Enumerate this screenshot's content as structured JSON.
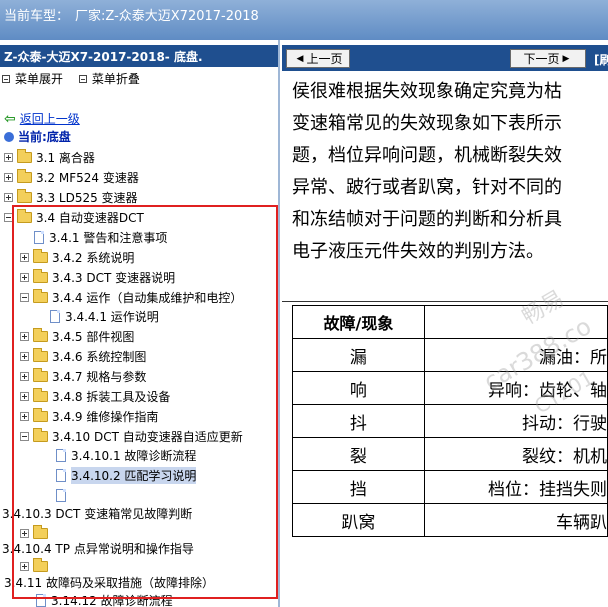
{
  "topbar": {
    "label": "当前车型：",
    "model": "厂家:Z-众泰大迈X72017-2018"
  },
  "left": {
    "title": "Z-众泰-大迈X7-2017-2018- 底盘.",
    "menu_expand": "菜单展开",
    "menu_collapse": "菜单折叠",
    "back": "返回上一级",
    "current": "当前:底盘",
    "items": [
      {
        "label": "3.1 离合器"
      },
      {
        "label": "3.2 MF524 变速器"
      },
      {
        "label": "3.3 LD525 变速器"
      },
      {
        "label": "3.4 自动变速器DCT"
      },
      {
        "label": "3.4.1 警告和注意事项"
      },
      {
        "label": "3.4.2 系统说明"
      },
      {
        "label": "3.4.3 DCT 变速器说明"
      },
      {
        "label": "3.4.4 运作（自动集成维护和电控）"
      },
      {
        "label": "3.4.4.1 运作说明"
      },
      {
        "label": "3.4.5 部件视图"
      },
      {
        "label": "3.4.6 系统控制图"
      },
      {
        "label": "3.4.7 规格与参数"
      },
      {
        "label": "3.4.8 拆装工具及设备"
      },
      {
        "label": "3.4.9 维修操作指南"
      },
      {
        "label": "3.4.10 DCT 自动变速器自适应更新"
      },
      {
        "label": "3.4.10.1 故障诊断流程"
      },
      {
        "label": "3.4.10.2 匹配学习说明"
      },
      {
        "label": "3.4.10.3 DCT 变速箱常见故障判断"
      },
      {
        "label": "3.4.10.4 TP 点异常说明和操作指导"
      },
      {
        "label": "3.4.11 故障码及采取措施（故障排除）"
      },
      {
        "label": "3.14.12 故障诊断流程"
      }
    ]
  },
  "right": {
    "prev": "上一页",
    "next": "下一页",
    "refresh": "[刷",
    "lines": [
      "侯很难根据失效现象确定究竟为枯",
      "变速箱常见的失效现象如下表所示",
      "题，档位异响问题，机械断裂失效",
      "异常、跛行或者趴窝，针对不同的",
      "和冻结帧对于问题的判断和分析具",
      "电子液压元件失效的判别方法。"
    ],
    "table": {
      "header": "故障/现象",
      "rows": [
        {
          "name": "漏",
          "desc": "漏油：所"
        },
        {
          "name": "响",
          "desc": "异响：齿轮、轴"
        },
        {
          "name": "抖",
          "desc": "抖动：行驶"
        },
        {
          "name": "裂",
          "desc": "裂纹：机机"
        },
        {
          "name": "挡",
          "desc": "档位：挂挡失则"
        },
        {
          "name": "趴窝",
          "desc": "车辆趴"
        }
      ]
    },
    "watermark1": "畅易",
    "watermark2": "car388.co",
    "watermark3": "CY201"
  }
}
